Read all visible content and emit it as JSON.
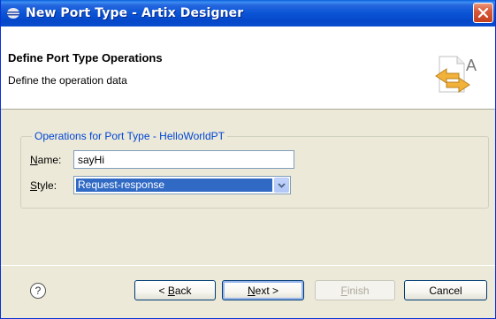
{
  "window": {
    "title": "New Port Type - Artix Designer",
    "close_glyph": "✕"
  },
  "header": {
    "title": "Define Port Type Operations",
    "description": "Define the operation data",
    "graphic_letter": "A"
  },
  "group": {
    "legend": "Operations for Port Type - HelloWorldPT",
    "name_label": {
      "mnemonic": "N",
      "rest": "ame:"
    },
    "name_value": "sayHi",
    "style_label": {
      "mnemonic": "S",
      "rest": "tyle:"
    },
    "style_value": "Request-response"
  },
  "footer": {
    "help_glyph": "?",
    "buttons": {
      "back": {
        "prefix": "< ",
        "mnemonic": "B",
        "rest": "ack"
      },
      "next": {
        "mnemonic": "N",
        "rest": "ext >"
      },
      "finish": {
        "mnemonic": "F",
        "rest": "inish"
      },
      "cancel": "Cancel"
    }
  },
  "icons": {
    "title": "eclipse-window-icon",
    "close": "close-icon",
    "header": "port-type-wizard-icon",
    "dropdown": "chevron-down-icon",
    "help": "help-icon"
  }
}
